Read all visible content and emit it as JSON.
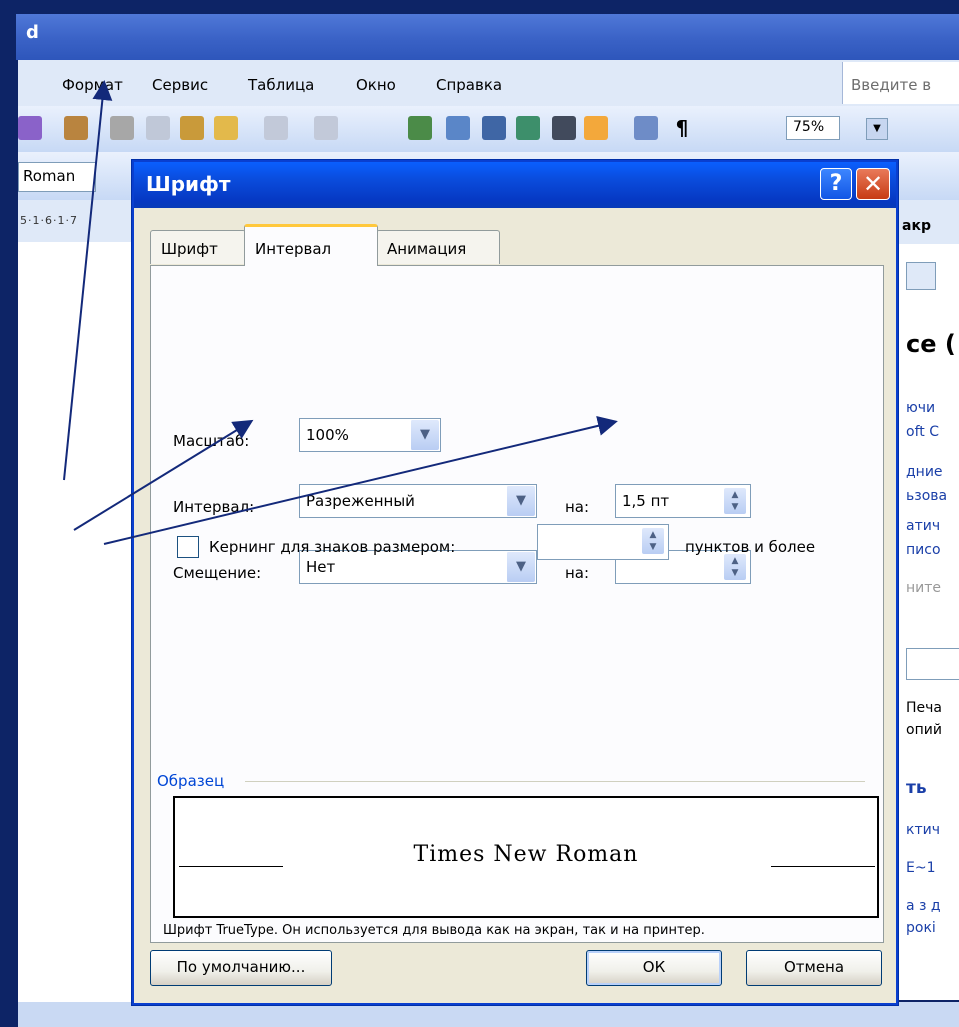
{
  "word": {
    "title_fragment": "d",
    "menu": [
      "Формат",
      "Сервис",
      "Таблица",
      "Окно",
      "Справка"
    ],
    "help_placeholder": "Введите в",
    "zoom": "75%",
    "font_name": "Roman",
    "ruler_text": "5·1·6·1·7",
    "taskpane": {
      "header": "акр",
      "heading": "ce (",
      "lines": [
        "ючи",
        "oft C",
        "дние",
        "ьзова",
        "атич",
        "писо",
        "ните"
      ],
      "lines2": [
        "Печа",
        "опий"
      ],
      "heading2": "ть",
      "lines3": [
        "ктич",
        "E~1",
        "а з д",
        "рокі"
      ]
    }
  },
  "dialog": {
    "title": "Шрифт",
    "help_label": "?",
    "close_label": "✕",
    "tabs": [
      {
        "label": "Шрифт",
        "active": false
      },
      {
        "label": "Интервал",
        "active": true
      },
      {
        "label": "Анимация",
        "active": false
      }
    ],
    "scale": {
      "label": "Масштаб:",
      "value": "100%"
    },
    "spacing": {
      "label": "Интервал:",
      "value": "Разреженный",
      "by_label": "на:",
      "by_value": "1,5 пт"
    },
    "position": {
      "label": "Смещение:",
      "value": "Нет",
      "by_label": "на:",
      "by_value": ""
    },
    "kerning": {
      "label": "Кернинг для знаков размером:",
      "value": "",
      "suffix": "пунктов и более",
      "checked": false
    },
    "sample": {
      "legend": "Образец",
      "text": "Times New Roman",
      "note": "Шрифт TrueType. Он используется для вывода как на экран, так и на принтер."
    },
    "buttons": {
      "default": "По умолчанию...",
      "ok": "ОК",
      "cancel": "Отмена"
    }
  },
  "colors": {
    "title_bar": "#0a4bdb",
    "close_button": "#c73b14",
    "active_tab_accent": "#ffc83c",
    "arrow": "#13297a"
  }
}
